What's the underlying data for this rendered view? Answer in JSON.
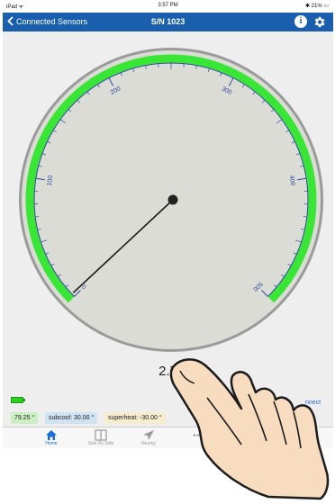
{
  "status_bar": {
    "carrier": "iPad ᯤ",
    "time": "3:57 PM",
    "battery": "✱ 21% ▭"
  },
  "nav": {
    "back_label": "Connected Sensors",
    "title": "S/N 1023"
  },
  "gauge": {
    "min": 0,
    "max": 500,
    "tick_labels": [
      "0",
      "100",
      "200",
      "300",
      "400",
      "500"
    ],
    "needle_value": 2.7,
    "colors": {
      "arc": "#39e636",
      "ticks": "#2a4a9a",
      "face": "#dcdcd6"
    }
  },
  "readout": {
    "value": "2.7"
  },
  "chips": {
    "temperature": "79.25 °",
    "subcool": "subcool: 30.00 °",
    "superheat": "superheat: -30.00 °"
  },
  "connect_label": "nnect",
  "tabs": [
    {
      "label": "Home",
      "icon": "home-icon"
    },
    {
      "label": "Side By Side",
      "icon": "split-view-icon"
    },
    {
      "label": "Nearby",
      "icon": "location-arrow-icon"
    },
    {
      "label": "",
      "icon": "more-icon"
    }
  ]
}
